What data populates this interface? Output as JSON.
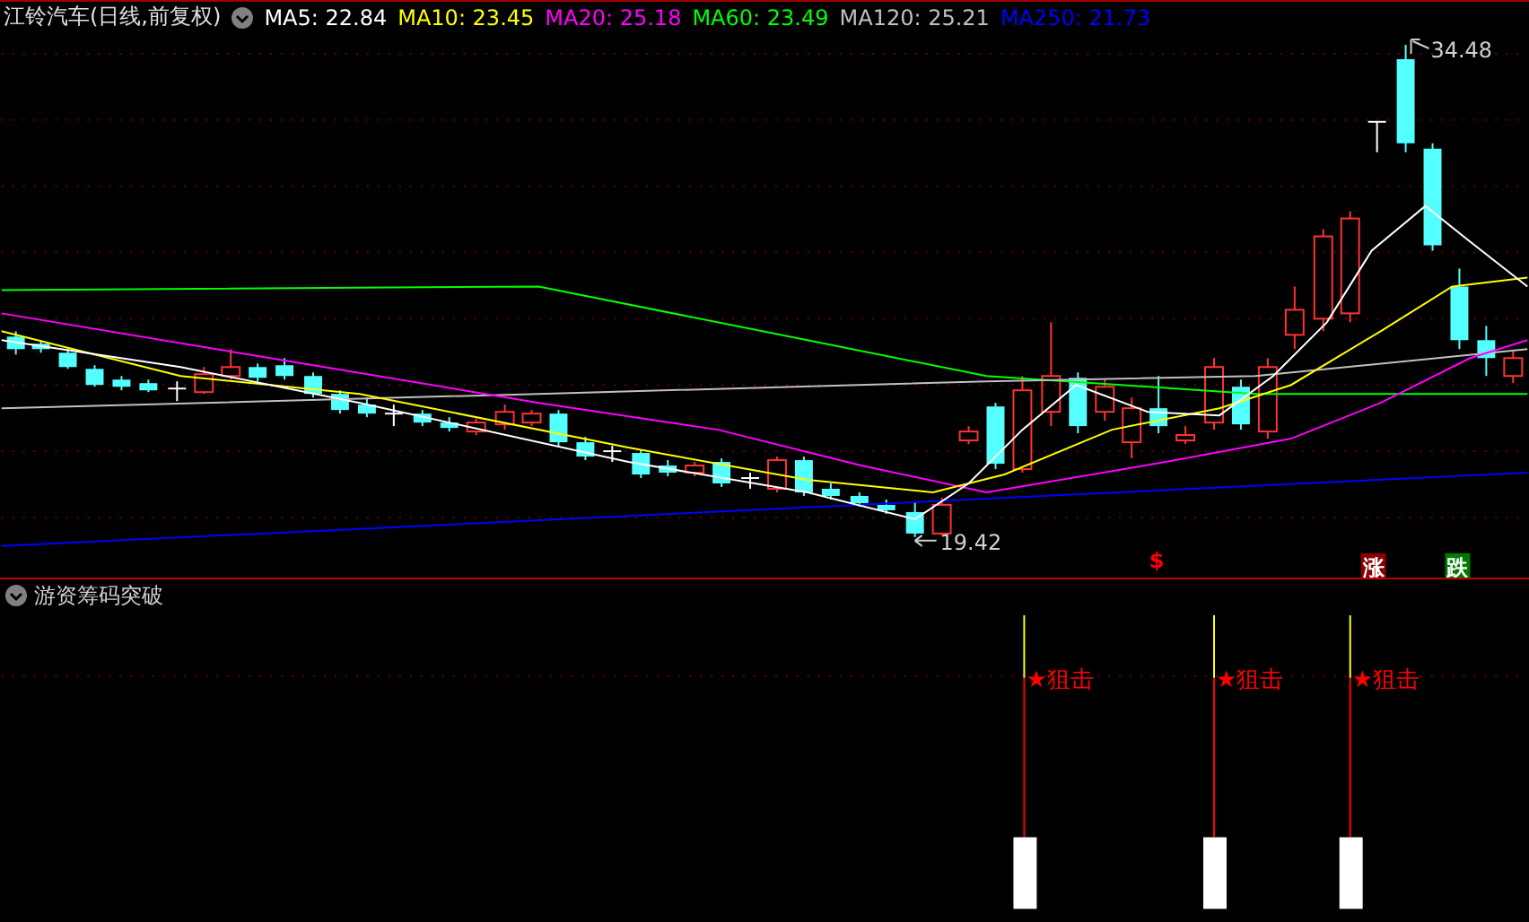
{
  "chart_header": {
    "title": "江铃汽车(日线,前复权)",
    "ma_legend": [
      {
        "label": "MA5:",
        "value": "22.84",
        "color": "#ffffff"
      },
      {
        "label": "MA10:",
        "value": "23.45",
        "color": "#ffff00"
      },
      {
        "label": "MA20:",
        "value": "25.18",
        "color": "#ff00ff"
      },
      {
        "label": "MA60:",
        "value": "23.49",
        "color": "#00ff00"
      },
      {
        "label": "MA120:",
        "value": "25.21",
        "color": "#c0c0c0"
      },
      {
        "label": "MA250:",
        "value": "21.73",
        "color": "#0000ff"
      }
    ]
  },
  "price_chart": {
    "high_label": "34.48",
    "low_label": "19.42",
    "markers": [
      {
        "kind": "symbol",
        "text": "$"
      },
      {
        "kind": "rise",
        "text": "涨"
      },
      {
        "kind": "fall",
        "text": "跌"
      }
    ]
  },
  "indicator": {
    "title": "游资筹码突破",
    "signals": [
      {
        "text": "★狙击"
      },
      {
        "text": "★狙击"
      },
      {
        "text": "★狙击"
      }
    ]
  }
}
